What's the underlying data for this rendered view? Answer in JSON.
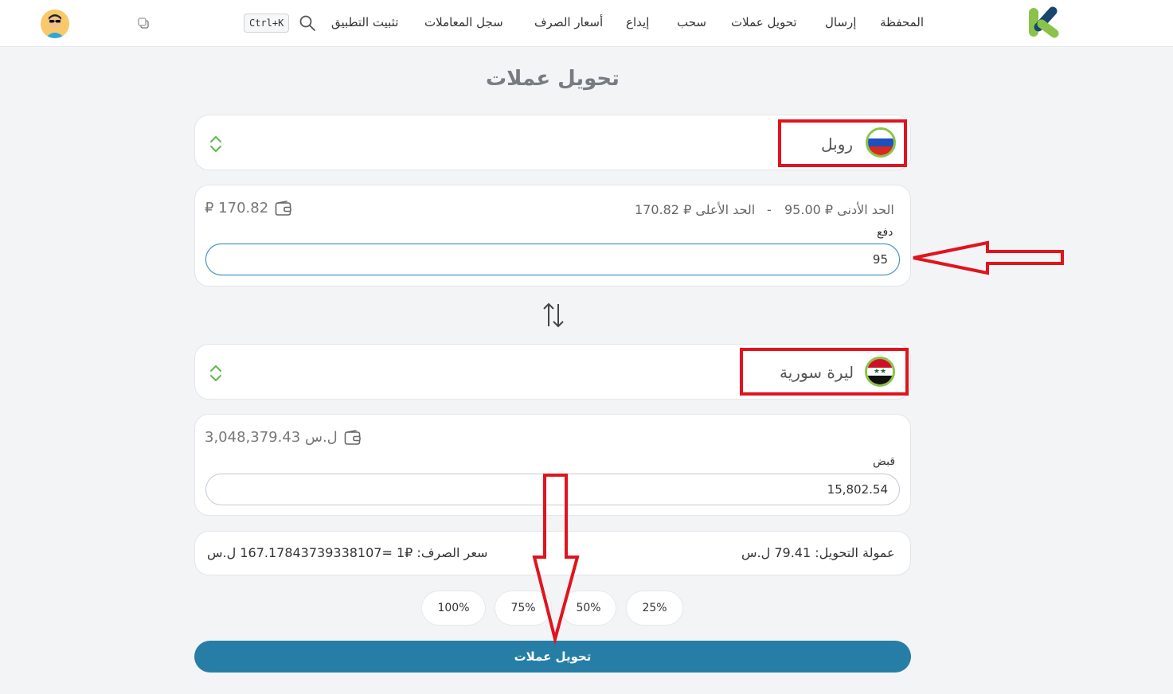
{
  "header": {
    "nav": [
      {
        "label": "المحفظة"
      },
      {
        "label": "إرسال"
      },
      {
        "label": "تحويل عملات"
      },
      {
        "label": "سحب"
      },
      {
        "label": "إيداع"
      },
      {
        "label": "أسعار الصرف"
      },
      {
        "label": "سجل المعاملات"
      },
      {
        "label": "تثبيت التطبيق"
      }
    ],
    "search_shortcut": "Ctrl+K",
    "brand_color": "#8bc34a",
    "brand_color_dark": "#17466e"
  },
  "page": {
    "title": "تحويل عملات"
  },
  "from": {
    "currency_name": "روبل",
    "flag_icon": "russia-flag-icon",
    "limits_min": "الحد الأدنى ₽ 95.00",
    "limits_sep": "-",
    "limits_max": "الحد الأعلى ₽ 170.82",
    "balance": "₽ 170.82",
    "label": "دفع",
    "amount": "95"
  },
  "to": {
    "currency_name": "ليرة سورية",
    "flag_icon": "syria-flag-icon",
    "balance": "3,048,379.43 ل.س",
    "label": "قبض",
    "amount": "15,802.54"
  },
  "summary": {
    "fee": "عمولة التحويل: 79.41 ل.س",
    "rate": "سعر الصرف: ₽1 =167.17843739338107 ل.س"
  },
  "percent_buttons": [
    {
      "label": "25%"
    },
    {
      "label": "50%"
    },
    {
      "label": "75%"
    },
    {
      "label": "100%"
    }
  ],
  "submit": {
    "label": "تحويل عملات",
    "color": "#267ea7"
  },
  "annotation_color": "#e0141e"
}
